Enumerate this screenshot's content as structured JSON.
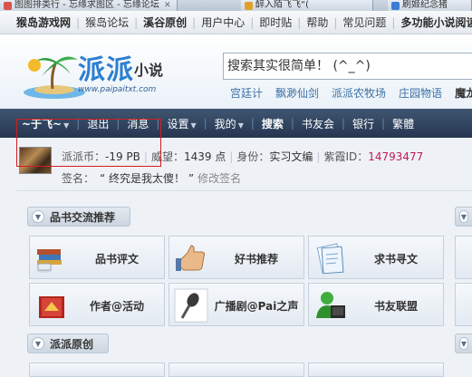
{
  "browser_tabs": [
    {
      "label": "图图排类行 - 忘缘求图区 - 忘缘论坛",
      "color": "#d9534f"
    },
    {
      "label": "醉入陌飞飞“(",
      "color": "#e0a12a"
    },
    {
      "label": "刷姬纪念猪",
      "color": "#3b7bd4"
    }
  ],
  "topnav": {
    "items": [
      "猴岛游戏网",
      "猴岛论坛",
      "溪谷原创",
      "用户中心",
      "即时贴",
      "帮助",
      "常见问题",
      "多功能小说阅读器"
    ]
  },
  "header": {
    "logo_text": "派派",
    "logo_small": "小说",
    "logo_url": "www.paipaitxt.com",
    "search_value": "搜索其实很简单！ (^_^)",
    "sublinks": [
      "宫廷计",
      "飘渺仙剑",
      "派派农牧场",
      "庄园物语",
      "魔龙"
    ]
  },
  "usernav": {
    "username": "~于飞~",
    "logout": "退出",
    "messages": "消息",
    "settings": "设置",
    "mine": "我的",
    "search": "搜索",
    "friends": "书友会",
    "bank": "银行",
    "simplified": "繁體"
  },
  "userinfo": {
    "coin_label": "派派币：",
    "coin_value": "-19 PB",
    "prestige_label": "威望：",
    "prestige_value": "1439 点",
    "identity_label": "身份：",
    "identity_value": "实习文编",
    "id_label": "紫霞ID：",
    "id_value": "14793477",
    "sig_label": "签名：",
    "sig_value": "“ 终究是我太傻！ ”",
    "sig_edit": "修改签名"
  },
  "sections": {
    "exchange_title": "品书交流推荐",
    "original_title": "派派原创"
  },
  "tiles": [
    {
      "label": "品书评文",
      "icon": "tea-books-icon"
    },
    {
      "label": "好书推荐",
      "icon": "thumbs-up-icon"
    },
    {
      "label": "求书寻文",
      "icon": "document-icon"
    },
    {
      "label": "作者@活动",
      "icon": "red-book-icon"
    },
    {
      "label": "广播剧@Pai之声",
      "icon": "microphone-icon"
    },
    {
      "label": "书友联盟",
      "icon": "users-icon"
    }
  ],
  "colors": {
    "nav_dark": "#2e4260",
    "id_pink": "#c2185b",
    "link_blue": "#3c6fa6",
    "highlight_red": "#d21e1e"
  }
}
